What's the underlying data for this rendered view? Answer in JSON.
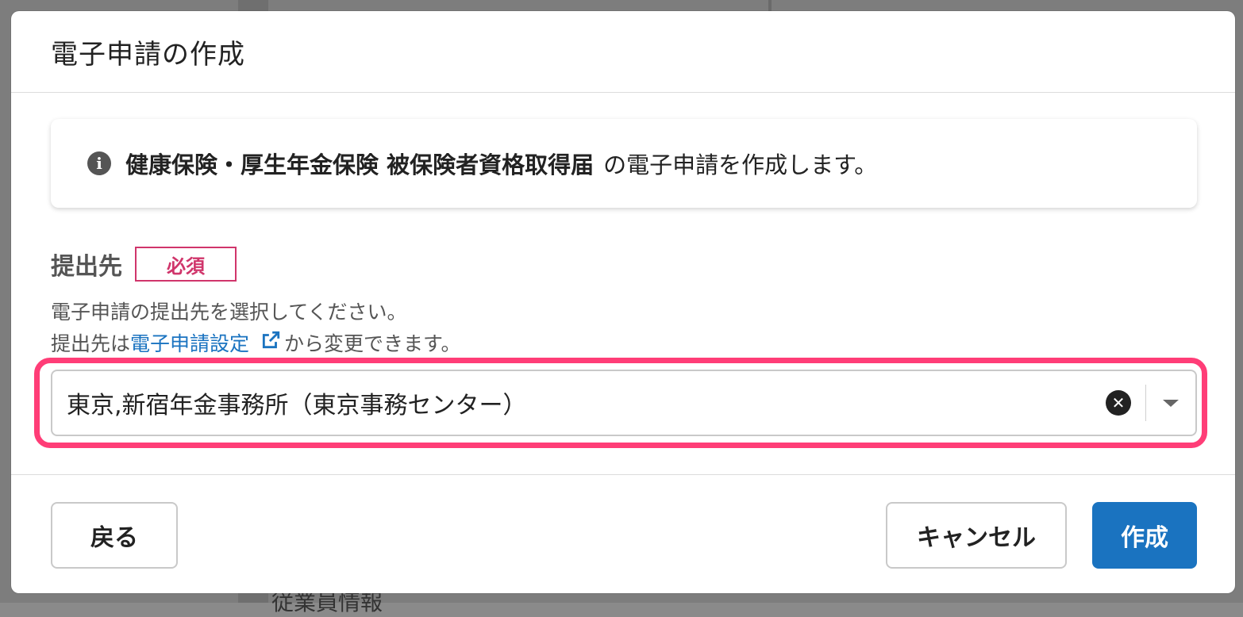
{
  "dialog": {
    "title": "電子申請の作成",
    "info": {
      "icon": "info-icon",
      "bold_text": "健康保険・厚生年金保険 被保険者資格取得届",
      "rest_text": "の電子申請を作成します。"
    },
    "field": {
      "label": "提出先",
      "required_badge": "必須",
      "help_line1": "電子申請の提出先を選択してください。",
      "help_line2_prefix": "提出先は",
      "help_link": "電子申請設定",
      "help_link_icon": "external-link-icon",
      "help_line2_suffix": "から変更できます。",
      "selected_value": "東京,新宿年金事務所（東京事務センター）",
      "clear_icon": "clear-icon",
      "dropdown_icon": "chevron-down-icon"
    },
    "buttons": {
      "back": "戻る",
      "cancel": "キャンセル",
      "create": "作成"
    }
  },
  "background": {
    "partial_text": "従業員情報"
  },
  "colors": {
    "primary": "#1a73c0",
    "required": "#d0356b",
    "highlight": "#ff3d77"
  }
}
